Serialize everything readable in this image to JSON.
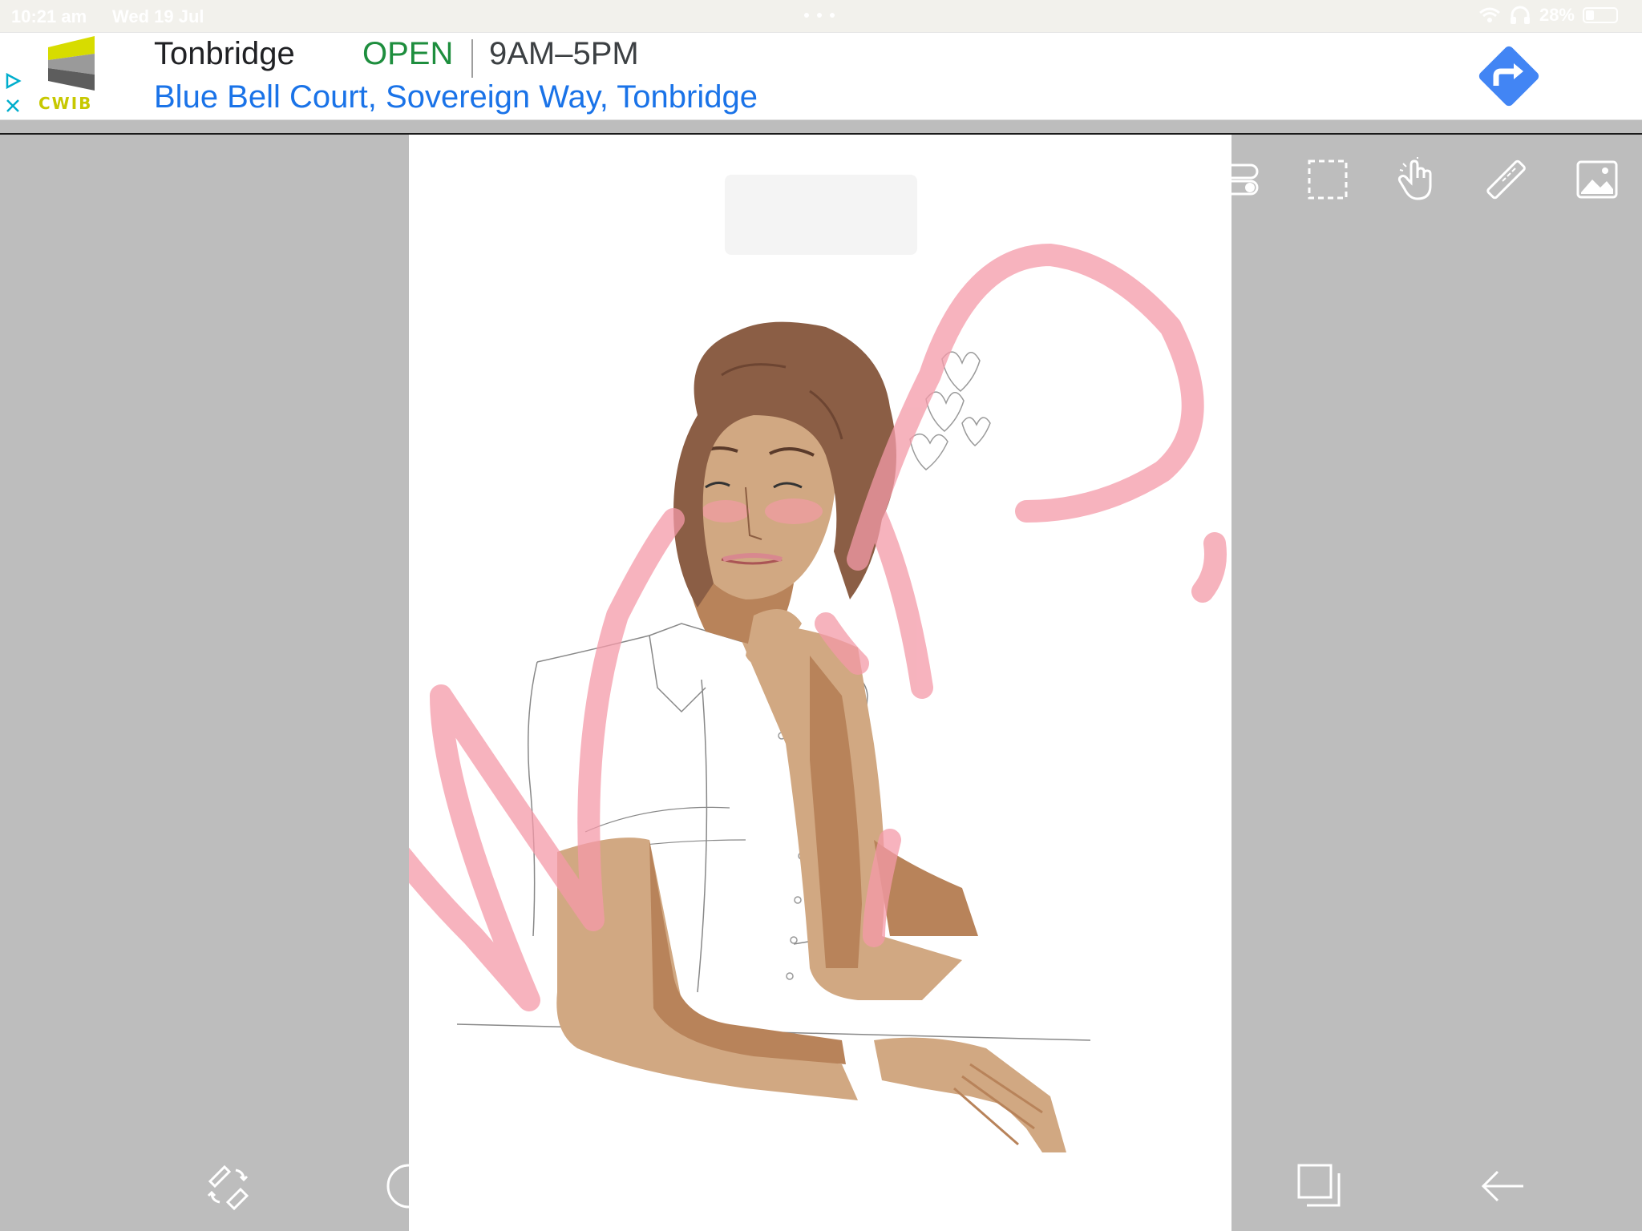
{
  "status_bar": {
    "time": "10:21 am",
    "date": "Wed 19 Jul",
    "battery": "28%",
    "wifi_icon": "wifi-icon",
    "headphones_icon": "headphones-icon",
    "battery_icon": "battery-icon"
  },
  "ad": {
    "title": "Tonbridge",
    "status": "OPEN",
    "hours": "9AM–5PM",
    "address": "Blue Bell Court, Sovereign Way, Tonbridge",
    "logo_text": "CWIB",
    "colors": {
      "open": "#1e8e3e",
      "address": "#1a73e8",
      "directions": "#4285f4"
    }
  },
  "toolbar_top": [
    {
      "name": "toggle-tool-icon"
    },
    {
      "name": "selection-tool-icon"
    },
    {
      "name": "hand-tool-icon"
    },
    {
      "name": "ruler-tool-icon"
    },
    {
      "name": "image-tool-icon"
    }
  ],
  "toolbar_bottom": [
    {
      "name": "brush-eraser-swap-icon"
    },
    {
      "name": "color-picker-icon"
    },
    {
      "name": "square-icon"
    },
    {
      "name": "upload-icon"
    },
    {
      "name": "undo-icon"
    },
    {
      "name": "redo-icon"
    },
    {
      "name": "layers-icon"
    },
    {
      "name": "back-arrow-icon"
    }
  ],
  "colors": {
    "background": "#bdbdbd",
    "canvas": "#ffffff",
    "watermark": "#f49aa8",
    "skin": "#d1a882",
    "skin_shadow": "#b8835a",
    "hair": "#8b5e45"
  }
}
